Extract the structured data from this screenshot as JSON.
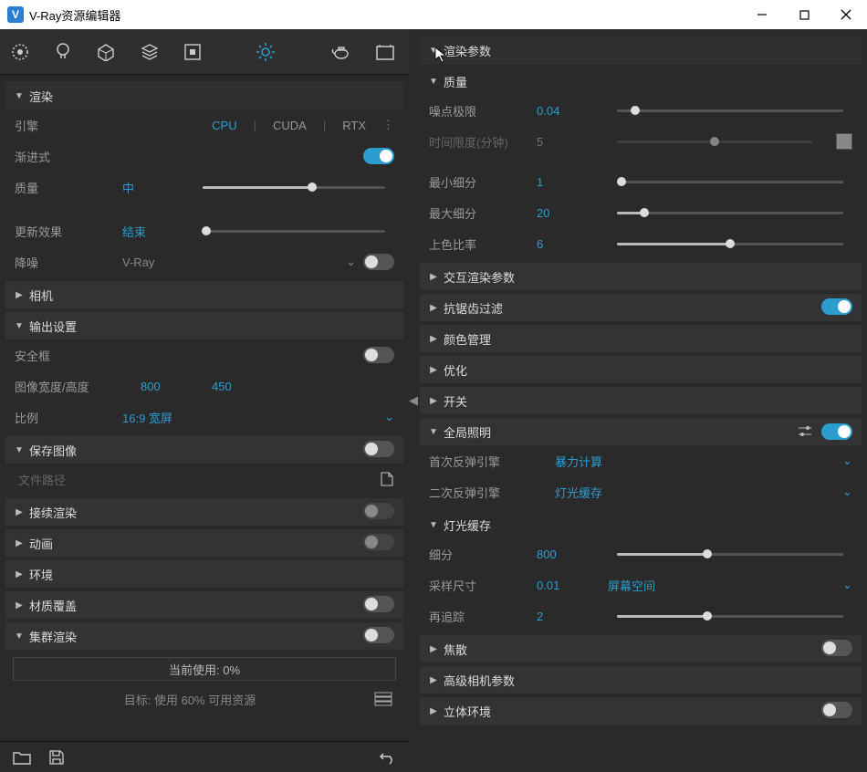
{
  "window": {
    "title": "V-Ray资源编辑器"
  },
  "left": {
    "render_header": "渲染",
    "engine": {
      "label": "引擎",
      "cpu": "CPU",
      "cuda": "CUDA",
      "rtx": "RTX"
    },
    "progressive": "渐进式",
    "quality": {
      "label": "质量",
      "value": "中"
    },
    "update_effect": {
      "label": "更新效果",
      "value": "结束"
    },
    "denoise": {
      "label": "降噪",
      "value": "V-Ray"
    },
    "camera": "相机",
    "output_settings": "输出设置",
    "safe_frame": "安全框",
    "image_wh": {
      "label": "图像宽度/高度",
      "w": "800",
      "h": "450"
    },
    "ratio": {
      "label": "比例",
      "value": "16:9 宽屏"
    },
    "save_image": "保存图像",
    "file_path_placeholder": "文件路径",
    "resume_render": "接续渲染",
    "animation": "动画",
    "environment": "环境",
    "material_override": "材质覆盖",
    "swarm": "集群渲染",
    "usage_now": "当前使用: 0%",
    "usage_target": "目标: 使用 60% 可用资源"
  },
  "right": {
    "render_params": "渲染参数",
    "quality_section": "质量",
    "noise_limit": {
      "label": "噪点极限",
      "value": "0.04"
    },
    "time_limit": {
      "label": "时间限度(分钟)",
      "value": "5"
    },
    "min_subdivs": {
      "label": "最小细分",
      "value": "1"
    },
    "max_subdivs": {
      "label": "最大细分",
      "value": "20"
    },
    "shading_rate": {
      "label": "上色比率",
      "value": "6"
    },
    "interactive": "交互渲染参数",
    "antialias": "抗锯齿过滤",
    "color_mgmt": "颜色管理",
    "optimize": "优化",
    "switches": "开关",
    "gi": "全局照明",
    "first_bounce": {
      "label": "首次反弹引擎",
      "value": "暴力计算"
    },
    "second_bounce": {
      "label": "二次反弹引擎",
      "value": "灯光缓存"
    },
    "light_cache": "灯光缓存",
    "lc_subdivs": {
      "label": "细分",
      "value": "800"
    },
    "lc_sample": {
      "label": "采样尺寸",
      "value": "0.01",
      "mode": "屏幕空间"
    },
    "lc_retrace": {
      "label": "再追踪",
      "value": "2"
    },
    "caustics": "焦散",
    "adv_camera": "高级相机参数",
    "stereo": "立体环境"
  }
}
